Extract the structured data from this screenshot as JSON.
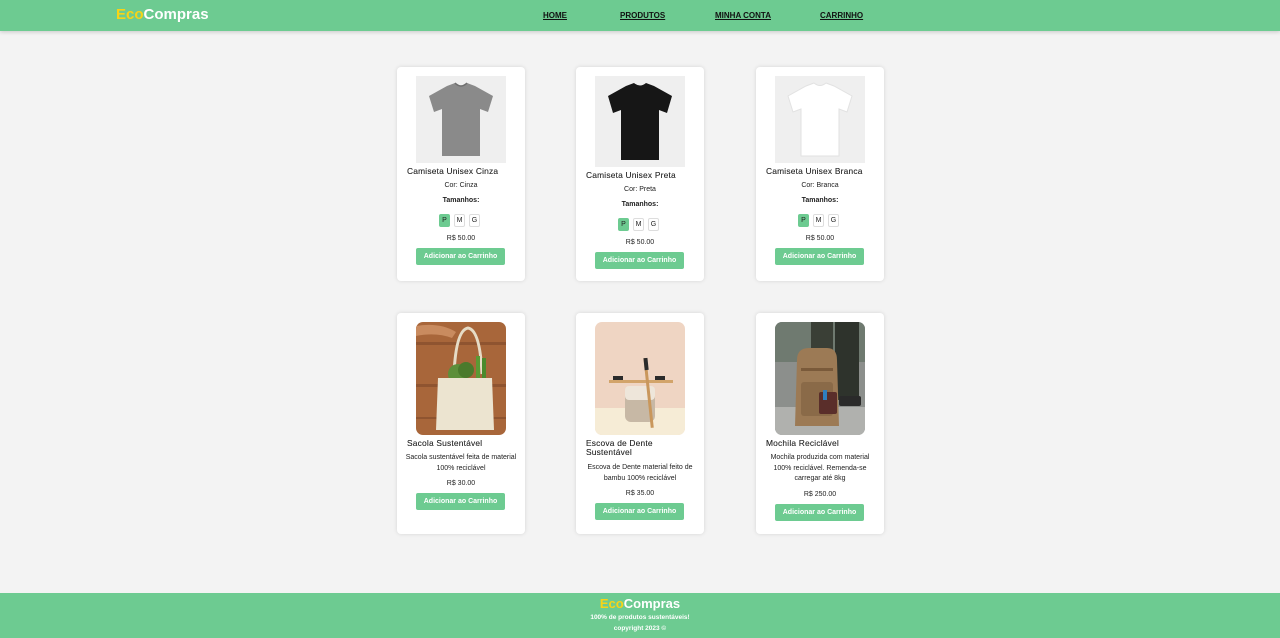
{
  "brand": {
    "part1": "Eco",
    "part2": "Compras"
  },
  "nav": [
    "HOME",
    "PRODUTOS",
    "MINHA CONTA",
    "CARRINHO"
  ],
  "products": [
    {
      "title": "Camiseta Unisex Cinza",
      "color": "Cor: Cinza",
      "sizes_label": "Tamanhos:",
      "sizes": [
        "P",
        "M",
        "G"
      ],
      "selected_size": "P",
      "price": "R$ 50.00",
      "button": "Adicionar ao Carrinho",
      "image": "gray-tshirt"
    },
    {
      "title": "Camiseta Unisex Preta",
      "color": "Cor: Preta",
      "sizes_label": "Tamanhos:",
      "sizes": [
        "P",
        "M",
        "G"
      ],
      "selected_size": "P",
      "price": "R$ 50.00",
      "button": "Adicionar ao Carrinho",
      "image": "black-tshirt"
    },
    {
      "title": "Camiseta Unisex Branca",
      "color": "Cor: Branca",
      "sizes_label": "Tamanhos:",
      "sizes": [
        "P",
        "M",
        "G"
      ],
      "selected_size": "P",
      "price": "R$ 50.00",
      "button": "Adicionar ao Carrinho",
      "image": "white-tshirt"
    },
    {
      "title": "Sacola Sustentável",
      "description": "Sacola sustentável feita de material 100% reciclável",
      "price": "R$ 30.00",
      "button": "Adicionar ao Carrinho",
      "image": "tote-bag"
    },
    {
      "title": "Escova de Dente Sustentável",
      "description": "Escova de Dente material feito de bambu 100% reciclável",
      "price": "R$ 35.00",
      "button": "Adicionar ao Carrinho",
      "image": "bamboo-toothbrush"
    },
    {
      "title": "Mochila Reciclável",
      "description": "Mochila produzida com material 100% reciclável. Remenda-se carregar até 8kg",
      "price": "R$ 250.00",
      "button": "Adicionar ao Carrinho",
      "image": "backpack"
    }
  ],
  "footer": {
    "tagline": "100% de produtos sustentáveis!",
    "copyright": "copyright 2023 ©"
  },
  "colors": {
    "accent": "#6dcb91",
    "brand_yellow": "#f7d417"
  }
}
